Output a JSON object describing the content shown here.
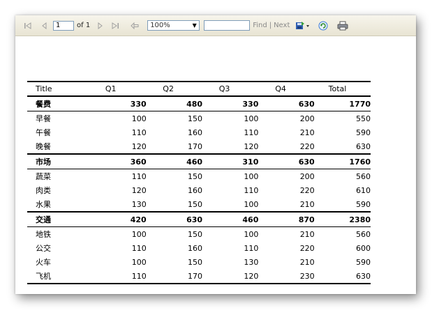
{
  "toolbar": {
    "page_value": "1",
    "of_label": "of 1",
    "zoom_value": "100%",
    "find_value": "",
    "find_label": "Find",
    "separator": "|",
    "next_label": "Next",
    "icons": [
      "first-page-icon",
      "previous-page-icon",
      "next-page-icon",
      "last-page-icon",
      "back-icon",
      "export-icon",
      "refresh-icon",
      "print-icon"
    ]
  },
  "table": {
    "headers": [
      "Title",
      "Q1",
      "Q2",
      "Q3",
      "Q4",
      "Total"
    ],
    "groups": [
      {
        "name": "餐费",
        "q1": "330",
        "q2": "480",
        "q3": "330",
        "q4": "630",
        "total": "1770",
        "rows": [
          {
            "name": "早餐",
            "q1": "100",
            "q2": "150",
            "q3": "100",
            "q4": "200",
            "total": "550"
          },
          {
            "name": "午餐",
            "q1": "110",
            "q2": "160",
            "q3": "110",
            "q4": "210",
            "total": "590"
          },
          {
            "name": "晚餐",
            "q1": "120",
            "q2": "170",
            "q3": "120",
            "q4": "220",
            "total": "630"
          }
        ]
      },
      {
        "name": "市场",
        "q1": "360",
        "q2": "460",
        "q3": "310",
        "q4": "630",
        "total": "1760",
        "rows": [
          {
            "name": "蔬菜",
            "q1": "110",
            "q2": "150",
            "q3": "100",
            "q4": "200",
            "total": "560"
          },
          {
            "name": "肉类",
            "q1": "120",
            "q2": "160",
            "q3": "110",
            "q4": "220",
            "total": "610"
          },
          {
            "name": "水果",
            "q1": "130",
            "q2": "150",
            "q3": "100",
            "q4": "210",
            "total": "590"
          }
        ]
      },
      {
        "name": "交通",
        "q1": "420",
        "q2": "630",
        "q3": "460",
        "q4": "870",
        "total": "2380",
        "rows": [
          {
            "name": "地铁",
            "q1": "100",
            "q2": "150",
            "q3": "100",
            "q4": "210",
            "total": "560"
          },
          {
            "name": "公交",
            "q1": "110",
            "q2": "160",
            "q3": "110",
            "q4": "220",
            "total": "600"
          },
          {
            "name": "火车",
            "q1": "100",
            "q2": "150",
            "q3": "130",
            "q4": "210",
            "total": "590"
          },
          {
            "name": "飞机",
            "q1": "110",
            "q2": "170",
            "q3": "120",
            "q4": "230",
            "total": "630"
          }
        ]
      }
    ]
  }
}
